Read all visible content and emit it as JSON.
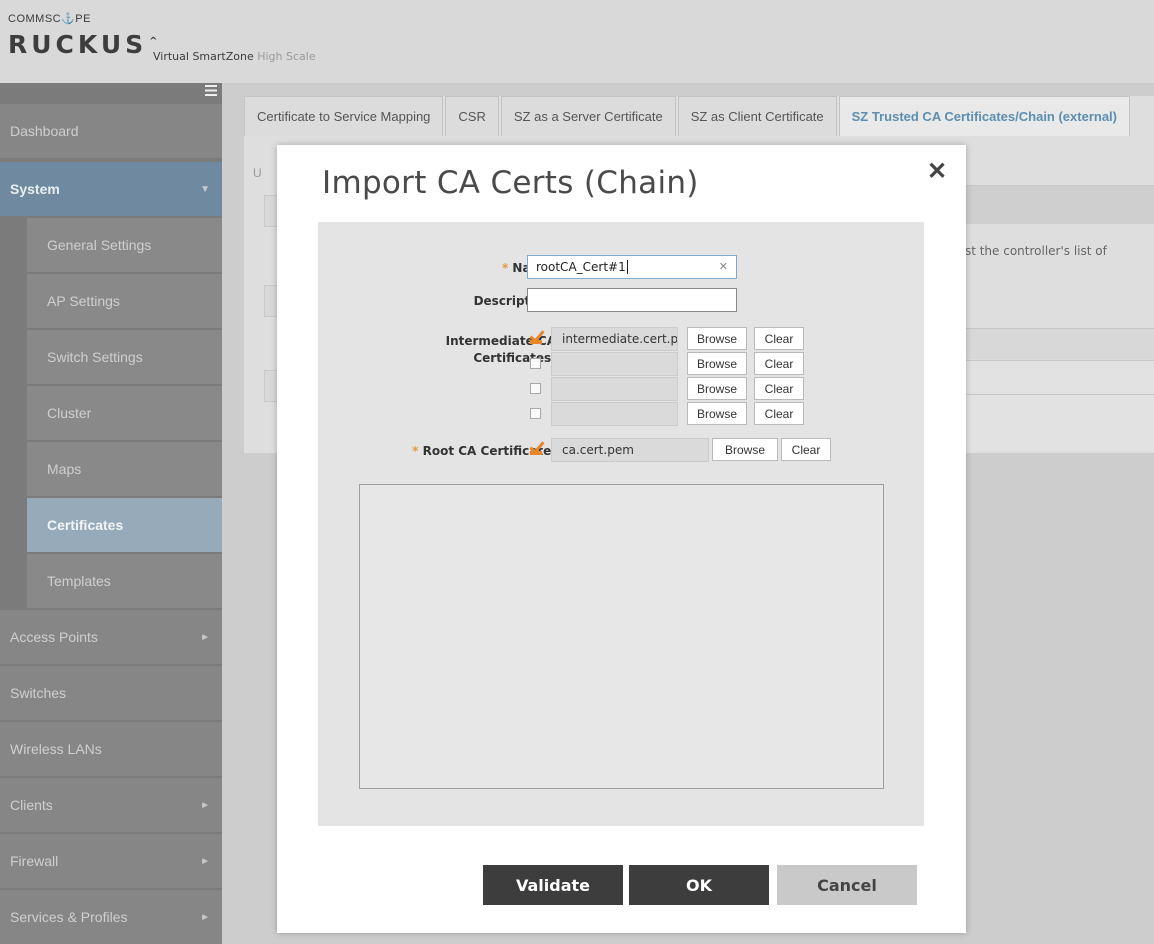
{
  "header": {
    "brand_small": "COMMSC⚓PE",
    "brand_big": "RUCKUS",
    "brand_mark": "^",
    "product_name": "Virtual SmartZone",
    "product_suffix": "High Scale"
  },
  "sidebar": {
    "menu_icon": "hamburger-icon",
    "items": [
      {
        "label": "Dashboard"
      },
      {
        "label": "System",
        "arrow": "▼"
      },
      {
        "label": "General Settings"
      },
      {
        "label": "AP Settings"
      },
      {
        "label": "Switch Settings"
      },
      {
        "label": "Cluster"
      },
      {
        "label": "Maps"
      },
      {
        "label": "Certificates"
      },
      {
        "label": "Templates"
      },
      {
        "label": "Access Points",
        "arrow": "►"
      },
      {
        "label": "Switches"
      },
      {
        "label": "Wireless LANs"
      },
      {
        "label": "Clients",
        "arrow": "►"
      },
      {
        "label": "Firewall",
        "arrow": "►"
      },
      {
        "label": "Services & Profiles",
        "arrow": "►"
      }
    ]
  },
  "tabs": [
    {
      "label": "Certificate to Service Mapping"
    },
    {
      "label": "CSR"
    },
    {
      "label": "SZ as a Server Certificate"
    },
    {
      "label": "SZ as Client Certificate"
    },
    {
      "label": "SZ Trusted CA Certificates/Chain (external)"
    }
  ],
  "background": {
    "partial_text": "inst the controller's list of",
    "partial_u": "U"
  },
  "modal": {
    "title": "Import CA Certs (Chain)",
    "close_icon": "✕",
    "required_mark": "*",
    "name_label": "Name:",
    "name_value": "rootCA_Cert#1",
    "description_label": "Description:",
    "description_value": "",
    "intermediate_label_1": "Intermediate CA",
    "intermediate_label_2": "Certificates:",
    "intermediate_rows": [
      {
        "file": "intermediate.cert.pem",
        "checked": true
      },
      {
        "file": "",
        "checked": false
      },
      {
        "file": "",
        "checked": false
      },
      {
        "file": "",
        "checked": false
      }
    ],
    "browse_label": "Browse",
    "clear_label": "Clear",
    "root_label": "Root CA Certificate:",
    "root_file": "ca.cert.pem",
    "buttons": {
      "validate": "Validate",
      "ok": "OK",
      "cancel": "Cancel"
    }
  },
  "colors": {
    "accent": "#5d8eb0",
    "required": "#e29a3a",
    "checkbox": "#e8862a",
    "dark_button": "#3d3d3d"
  }
}
